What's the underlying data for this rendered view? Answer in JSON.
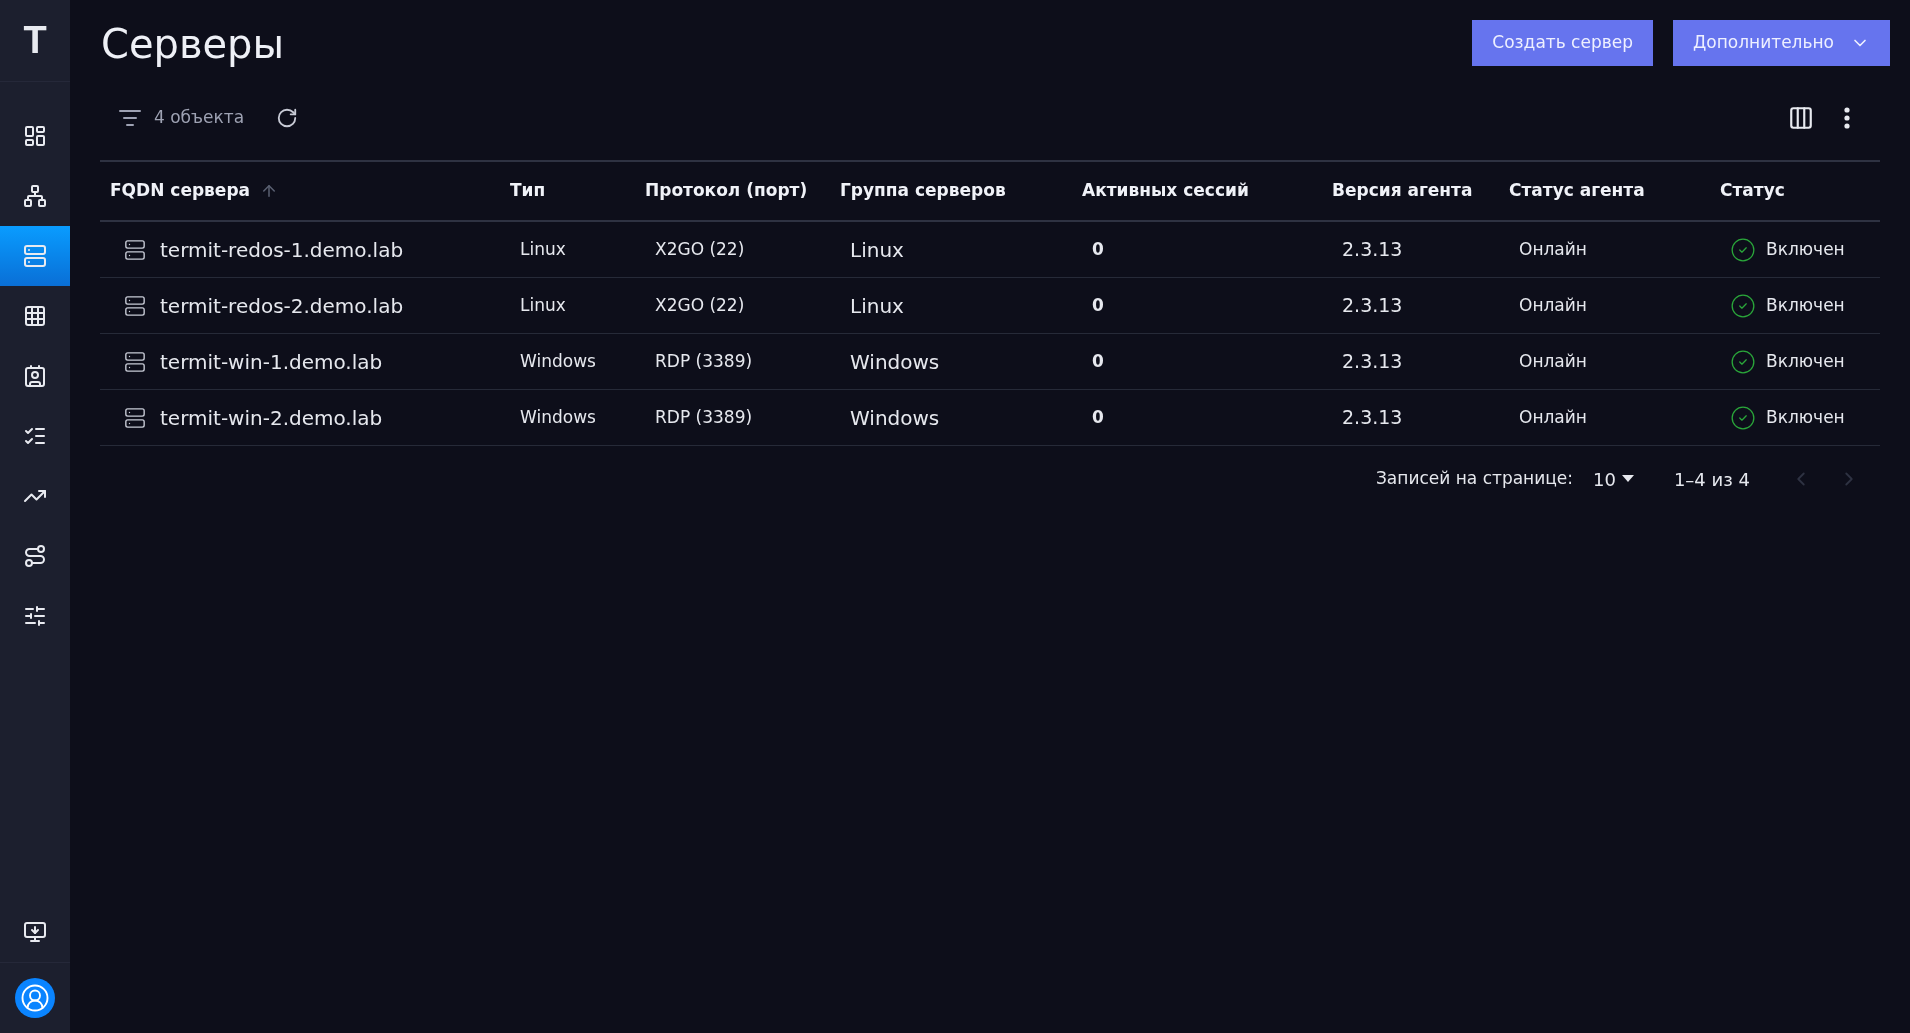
{
  "sidebar": {
    "logo": "T",
    "items": [
      {
        "selected": false
      },
      {
        "selected": false
      },
      {
        "selected": true
      },
      {
        "selected": false
      },
      {
        "selected": false
      },
      {
        "selected": false
      },
      {
        "selected": false
      },
      {
        "selected": false
      },
      {
        "selected": false
      }
    ],
    "bottom_items": [
      {
        "selected": false
      }
    ]
  },
  "page": {
    "title": "Серверы",
    "buttons": [
      {
        "label": "Создать сервер",
        "kind": "plain"
      },
      {
        "label": "Дополнительно",
        "kind": "dropdown"
      }
    ]
  },
  "toolbar": {
    "count": "4 объекта"
  },
  "table": {
    "columns": [
      {
        "label": "FQDN сервера",
        "sorted": true
      },
      {
        "label": "Тип",
        "sorted": false
      },
      {
        "label": "Протокол (порт)",
        "sorted": false
      },
      {
        "label": "Группа серверов",
        "sorted": false
      },
      {
        "label": "Активных сессий",
        "sorted": false
      },
      {
        "label": "Версия агента",
        "sorted": false
      },
      {
        "label": "Статус агента",
        "sorted": false
      },
      {
        "label": "Статус",
        "sorted": false
      }
    ],
    "rows": [
      {
        "fqdn": "termit-redos-1.demo.lab",
        "type": "Linux",
        "protocol": "X2GO (22)",
        "group": "Linux",
        "sessions": "0",
        "version": "2.3.13",
        "agent_status": "Онлайн",
        "status": "Включен",
        "enabled": true
      },
      {
        "fqdn": "termit-redos-2.demo.lab",
        "type": "Linux",
        "protocol": "X2GO (22)",
        "group": "Linux",
        "sessions": "0",
        "version": "2.3.13",
        "agent_status": "Онлайн",
        "status": "Включен",
        "enabled": true
      },
      {
        "fqdn": "termit-win-1.demo.lab",
        "type": "Windows",
        "protocol": "RDP (3389)",
        "group": "Windows",
        "sessions": "0",
        "version": "2.3.13",
        "agent_status": "Онлайн",
        "status": "Включен",
        "enabled": true
      },
      {
        "fqdn": "termit-win-2.demo.lab",
        "type": "Windows",
        "protocol": "RDP (3389)",
        "group": "Windows",
        "sessions": "0",
        "version": "2.3.13",
        "agent_status": "Онлайн",
        "status": "Включен",
        "enabled": true
      }
    ]
  },
  "pagination": {
    "label": "Записей на странице:",
    "per_page": "10",
    "range": "1–4 из 4",
    "prev_disabled": true,
    "next_disabled": true
  }
}
